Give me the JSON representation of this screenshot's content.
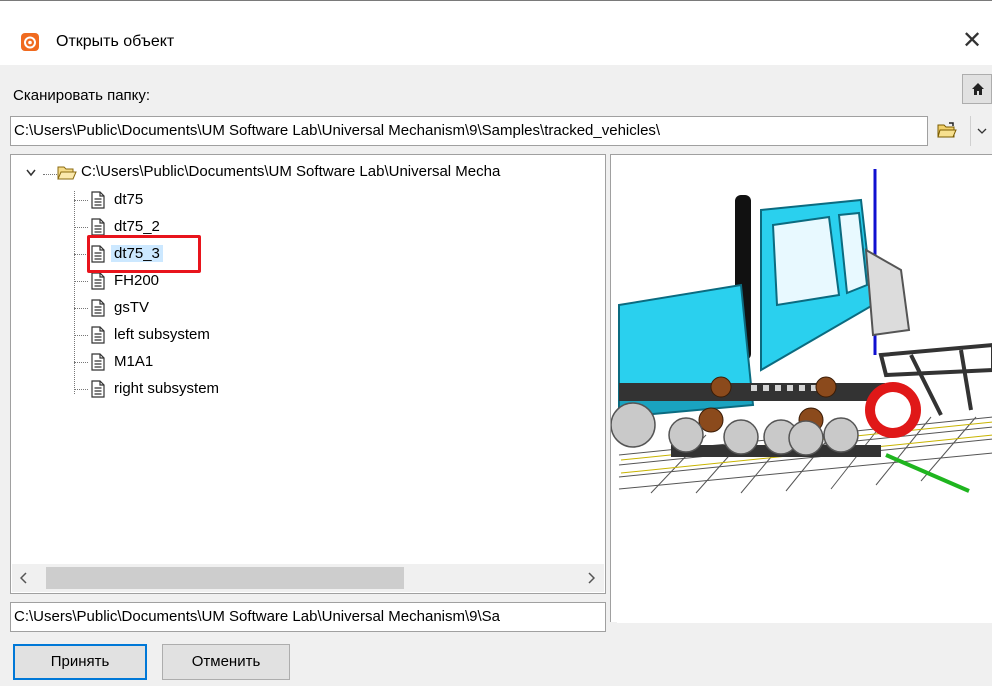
{
  "window": {
    "title": "Открыть объект",
    "close_symbol": "✕"
  },
  "scan": {
    "label": "Сканировать папку:",
    "path": "C:\\Users\\Public\\Documents\\UM Software Lab\\Universal Mechanism\\9\\Samples\\tracked_vehicles\\"
  },
  "tree": {
    "root_label": "C:\\Users\\Public\\Documents\\UM Software Lab\\Universal Mecha",
    "items": [
      {
        "label": "dt75"
      },
      {
        "label": "dt75_2"
      },
      {
        "label": "dt75_3"
      },
      {
        "label": "FH200"
      },
      {
        "label": "gsTV"
      },
      {
        "label": "left subsystem"
      },
      {
        "label": "M1A1"
      },
      {
        "label": "right subsystem"
      }
    ],
    "selected_index": 2
  },
  "selected_path": "C:\\Users\\Public\\Documents\\UM Software Lab\\Universal Mechanism\\9\\Sa",
  "buttons": {
    "accept": "Принять",
    "cancel": "Отменить"
  },
  "icons": {
    "app": "app-logo-icon",
    "home": "home-icon",
    "open_folder": "open-folder-icon",
    "dropdown": "chevron-down-icon",
    "expand": "chevron-down-icon",
    "folder": "folder-open-icon",
    "document": "document-icon"
  },
  "colors": {
    "highlight": "#e8141c",
    "selection": "#cce8ff",
    "accent": "#0078d7",
    "brand": "#f06a1f"
  }
}
